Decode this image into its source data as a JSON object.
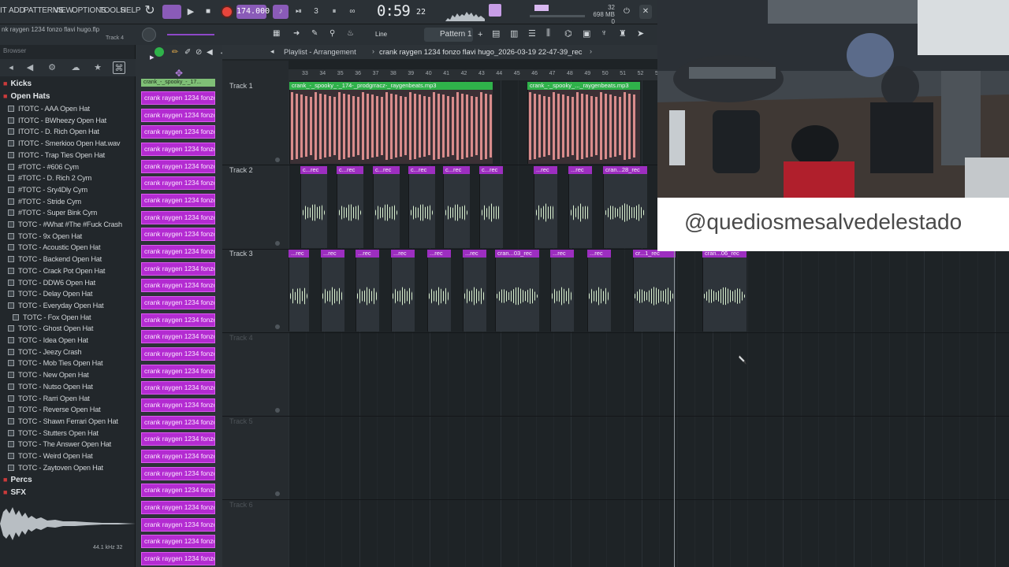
{
  "menu": [
    "IT",
    "ADD",
    "PATTERNS",
    "VIEW",
    "OPTIONS",
    "TOOLS",
    "HELP"
  ],
  "transport": {
    "tempo": "174.000",
    "time_main": "0:59",
    "time_ms": "22",
    "time_small_label": "M:S:CS",
    "memory_top": "32",
    "memory_value": "698 MB",
    "memory_bottom": "0"
  },
  "project": {
    "filename": "nk raygen 1234 fonzo flavi hugo.flp",
    "focused_track": "Track 4",
    "browser_label": "Browser"
  },
  "toolbar2": {
    "snap_label": "Line",
    "pattern_label": "Pattern 1"
  },
  "browser": {
    "folders": [
      {
        "label": "Kicks"
      },
      {
        "label": "Open Hats"
      }
    ],
    "items": [
      "ITOTC - AAA Open Hat",
      "ITOTC - BWheezy Open Hat",
      "ITOTC - D. Rich Open Hat",
      "ITOTC - Smerkioo Open Hat.wav",
      "ITOTC - Trap Ties Open Hat",
      "#TOTC - #606 Cym",
      "#TOTC - D. Rich 2 Cym",
      "#TOTC - Sry4Dly Cym",
      "#TOTC - Stride Cym",
      "#TOTC - Super Bink Cym",
      "TOTC - #What #The #Fuck Crash",
      "TOTC - 9x Open Hat",
      "TOTC - Acoustic Open Hat",
      "TOTC - Backend Open Hat",
      "TOTC - Crack Pot Open Hat",
      "TOTC - DDW6 Open Hat",
      "TOTC - Delay Open Hat",
      "TOTC - Everyday Open Hat",
      "TOTC - Fox Open Hat",
      "TOTC - Ghost Open Hat",
      "TOTC - Idea Open Hat",
      "TOTC - Jeezy Crash",
      "TOTC - Mob Ties Open Hat",
      "TOTC - New Open Hat",
      "TOTC - Nutso Open Hat",
      "TOTC - Rarri Open Hat",
      "TOTC - Reverse Open Hat",
      "TOTC - Shawn Ferrari Open Hat",
      "TOTC - Stutters Open Hat",
      "TOTC - The Answer Open Hat",
      "TOTC - Weird Open Hat",
      "TOTC - Zaytoven Open Hat"
    ],
    "folder_bottom": [
      {
        "label": "Percs"
      },
      {
        "label": "SFX"
      }
    ],
    "wave_info": "44.1 kHz 32"
  },
  "channels": {
    "first_label": "crank_-_spooky_-_17...",
    "repeat_label": "crank raygen 1234 fonzo..."
  },
  "playlist": {
    "title": "Playlist - Arrangement",
    "path": "crank raygen 1234 fonzo flavi hugo_2026-03-19 22-47-39_rec",
    "ruler": [
      "33",
      "34",
      "35",
      "36",
      "37",
      "38",
      "39",
      "40",
      "41",
      "42",
      "43",
      "44",
      "45",
      "46",
      "47",
      "48",
      "49",
      "50",
      "51",
      "52",
      "53"
    ],
    "tracks": [
      {
        "name": "Track 1"
      },
      {
        "name": "Track 2"
      },
      {
        "name": "Track 3"
      },
      {
        "name": "Track 4"
      },
      {
        "name": "Track 5"
      },
      {
        "name": "Track 6"
      }
    ],
    "track1_clips": [
      "crank_-_spooky_-_174-_prodgrracz-_raygenbeats.mp3",
      "crank_-_spooky_..._raygenbeats.mp3"
    ],
    "track2_clips": [
      "c...rec",
      "c...rec",
      "c...rec",
      "c...rec",
      "c...rec",
      "c...rec",
      "...rec",
      "...rec",
      "cran...28_rec"
    ],
    "track3_clips": [
      "...rec",
      "...rec",
      "...rec",
      "...rec",
      "...rec",
      "...rec",
      "cran...03_rec",
      "...rec",
      "...rec",
      "cr...1_rec",
      "cran...06_rec"
    ]
  },
  "overlay": {
    "handle": "@quediosmesalvedelestado"
  },
  "colors": {
    "accent_purple": "#b32bd1",
    "clip_green": "#2fb24a",
    "clip_pink": "#d98c8c",
    "record_red": "#e8453c"
  }
}
